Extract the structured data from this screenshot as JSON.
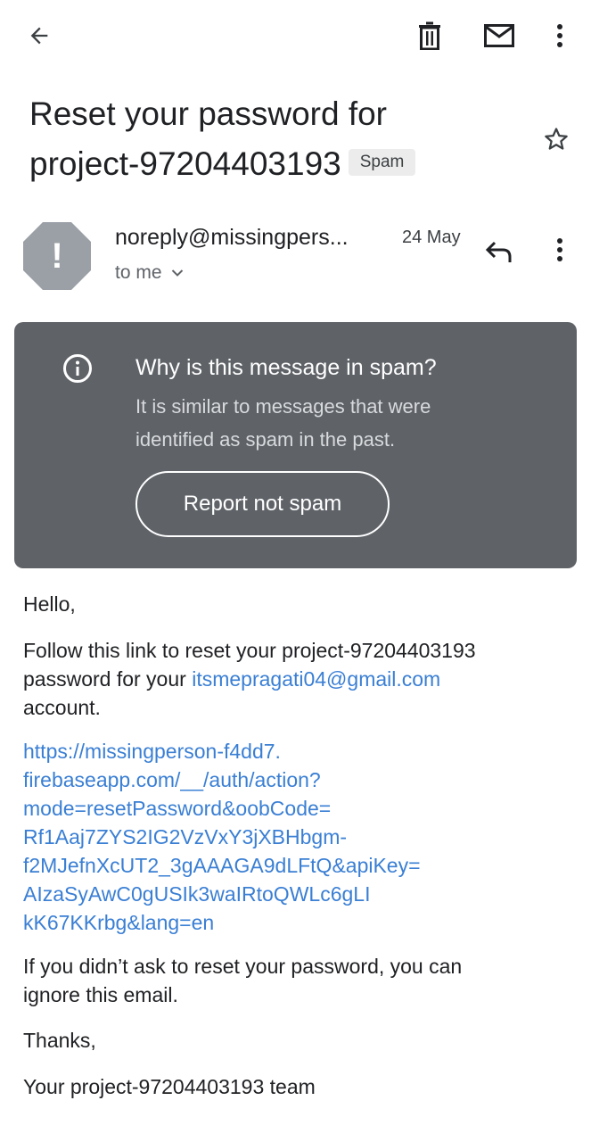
{
  "toolbar": {
    "back_icon": "arrow-left-icon",
    "delete_icon": "trash-icon",
    "mark_unread_icon": "mail-icon",
    "more_icon": "more-vert-icon"
  },
  "email": {
    "subject_line1": "Reset your password for",
    "subject_line2": "project-97204403193",
    "label": "Spam",
    "star_icon": "star-icon"
  },
  "sender": {
    "avatar_glyph": "!",
    "name": "noreply@missingpers...",
    "date": "24 May",
    "recipient": "to me",
    "reply_icon": "reply-icon"
  },
  "spam_notice": {
    "title": "Why is this message in spam?",
    "description_line1": "It is similar to messages that were",
    "description_line2": "identified as spam in the past.",
    "button_label": "Report not spam",
    "colors": {
      "card_bg": "#5f6368",
      "text": "#ffffff"
    }
  },
  "message": {
    "greeting": "Hello,",
    "para1_line1": "Follow this link to reset your project-97204403193",
    "para1_line2_prefix": "password for your ",
    "email_link": "itsmepragati04@gmail.com",
    "para1_line3": "account.",
    "reset_link_lines": [
      "https://missingperson-f4dd7.",
      "firebaseapp.com/__/auth/action?",
      "mode=resetPassword&oobCode=",
      "Rf1Aaj7ZYS2IG2VzVxY3jXBHbgm-",
      "f2MJefnXcUT2_3gAAAGA9dLFtQ&apiKey=",
      "AIzaSyAwC0gUSIk3waIRtoQWLc6gLI",
      "kK67KKrbg&lang=en"
    ],
    "ignore_line1": "If you didn’t ask to reset your password, you can",
    "ignore_line2": "ignore this email.",
    "thanks": "Thanks,",
    "signature": "Your project-97204403193 team"
  },
  "colors": {
    "link": "#3a7fd4",
    "text": "#202124"
  }
}
